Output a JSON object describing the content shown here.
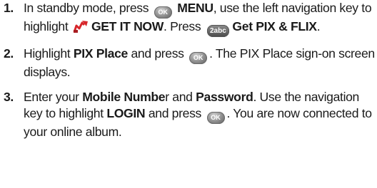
{
  "steps": [
    {
      "number": "1.",
      "parts": {
        "t1": "In standby mode, press",
        "ok_icon_label": "OK",
        "b1": "MENU",
        "t2": ", use the left navigation key to highlight",
        "b2": "GET IT NOW",
        "t3": ". Press",
        "key2_icon_label": "2abc",
        "b3": "Get PIX & FLIX",
        "t4": "."
      }
    },
    {
      "number": "2.",
      "parts": {
        "t1": "Highlight",
        "b1": "PIX Place",
        "t2": "and press",
        "ok_icon_label": "OK",
        "t3": ". The PIX Place sign-on screen displays."
      }
    },
    {
      "number": "3.",
      "parts": {
        "t1": "Enter your",
        "b1": "Mobile Numbe",
        "t2": "r and",
        "b2": "Password",
        "t3": ". Use the navigation key to highlight",
        "b3": "LOGIN",
        "t4": "and press",
        "ok_icon_label": "OK",
        "t5": ". You are now connected to your online album."
      }
    }
  ],
  "icons": {
    "ok": "ok-key-icon",
    "get_it_now": "get-it-now-icon",
    "key2": "number-2-key-icon"
  },
  "colors": {
    "text": "#1a1a1a",
    "icon_gray": "#8a8a8a",
    "icon_red": "#d7262b"
  }
}
